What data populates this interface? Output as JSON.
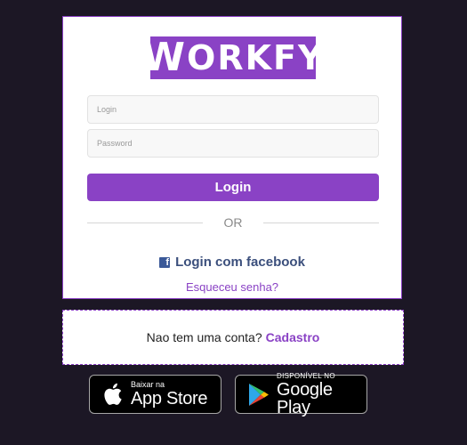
{
  "brand": {
    "logo_text_first": "W",
    "logo_text_rest": "ORKFY",
    "logo_color": "#8a42c5"
  },
  "form": {
    "login_placeholder": "Login",
    "password_placeholder": "Password",
    "login_button": "Login",
    "or_text": "OR",
    "facebook_label": "Login com facebook",
    "forgot_link": "Esqueceu senha?"
  },
  "signup": {
    "prompt": "Nao tem uma conta?",
    "link": "Cadastro"
  },
  "stores": {
    "appstore_small": "Baixar na",
    "appstore_big": "App Store",
    "googleplay_small": "DISPONÍVEL NO",
    "googleplay_big": "Google Play"
  },
  "icons": {
    "facebook": "facebook-icon",
    "apple": "apple-icon",
    "google_play": "google-play-icon"
  },
  "colors": {
    "accent": "#8a42c5",
    "background": "#1c1725",
    "facebook": "#3b5998"
  }
}
